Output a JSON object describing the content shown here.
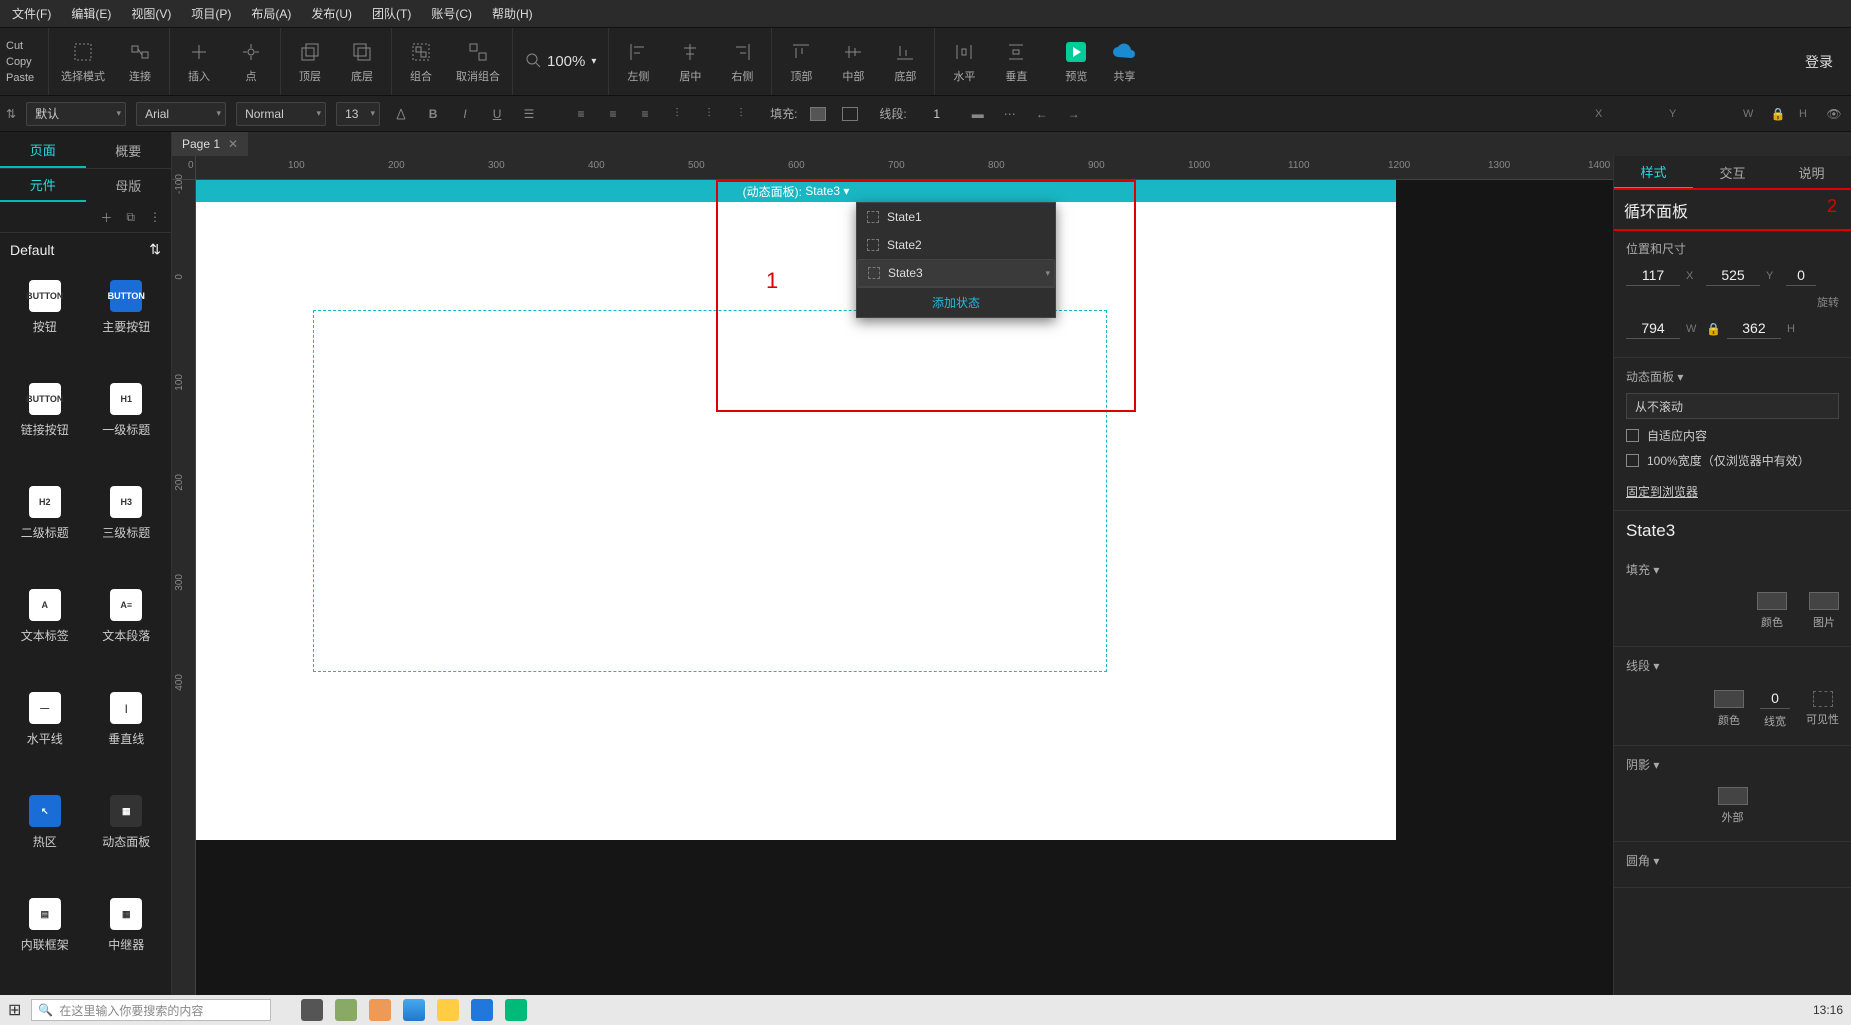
{
  "menubar": {
    "file": "文件(F)",
    "edit": "编辑(E)",
    "view": "视图(V)",
    "project": "项目(P)",
    "layout": "布局(A)",
    "publish": "发布(U)",
    "team": "团队(T)",
    "account": "账号(C)",
    "help": "帮助(H)"
  },
  "cutcopy": {
    "cut": "Cut",
    "copy": "Copy",
    "paste": "Paste"
  },
  "toolbar1": {
    "select_mode": "选择模式",
    "connect": "连接",
    "insert": "插入",
    "point": "点",
    "top_layer": "顶层",
    "bottom_layer": "底层",
    "group": "组合",
    "ungroup": "取消组合",
    "zoom_value": "100%",
    "align_left": "左侧",
    "align_center_h": "居中",
    "align_right": "右侧",
    "align_top": "顶部",
    "align_middle": "中部",
    "align_bottom": "底部",
    "dist_h": "水平",
    "dist_v": "垂直",
    "preview": "预览",
    "share": "共享",
    "login": "登录"
  },
  "toolbar2": {
    "default": "默认",
    "font": "Arial",
    "weight": "Normal",
    "size": "13",
    "fill_label": "填充:",
    "line_label": "线段:",
    "line_value": "1",
    "x": "X",
    "y": "Y",
    "w": "W",
    "h": "H"
  },
  "left": {
    "tab_page": "页面",
    "tab_outline": "概要",
    "tab_widgets": "元件",
    "tab_master": "母版",
    "lib_name": "Default",
    "items": [
      {
        "label": "按钮",
        "txt": "BUTTON",
        "cls": ""
      },
      {
        "label": "主要按钮",
        "txt": "BUTTON",
        "cls": "blue"
      },
      {
        "label": "链接按钮",
        "txt": "BUTTON",
        "cls": ""
      },
      {
        "label": "一级标题",
        "txt": "H1",
        "cls": ""
      },
      {
        "label": "二级标题",
        "txt": "H2",
        "cls": ""
      },
      {
        "label": "三级标题",
        "txt": "H3",
        "cls": ""
      },
      {
        "label": "文本标签",
        "txt": "A",
        "cls": ""
      },
      {
        "label": "文本段落",
        "txt": "A≡",
        "cls": ""
      },
      {
        "label": "水平线",
        "txt": "—",
        "cls": ""
      },
      {
        "label": "垂直线",
        "txt": "|",
        "cls": ""
      },
      {
        "label": "热区",
        "txt": "↖",
        "cls": "blue"
      },
      {
        "label": "动态面板",
        "txt": "▦",
        "cls": "dark"
      },
      {
        "label": "内联框架",
        "txt": "▤",
        "cls": ""
      },
      {
        "label": "中继器",
        "txt": "▦",
        "cls": ""
      }
    ]
  },
  "tab": {
    "page1": "Page 1"
  },
  "canvas": {
    "panel_label": "(动态面板):",
    "current_state": "State3",
    "states": [
      "State1",
      "State2",
      "State3"
    ],
    "add_state": "添加状态",
    "annot1": "1",
    "annot2": "2",
    "ruler_h": [
      "0",
      "100",
      "200",
      "300",
      "400",
      "500",
      "600",
      "700",
      "800",
      "900",
      "1000",
      "1100",
      "1200",
      "1300",
      "1400"
    ],
    "ruler_v": [
      "-100",
      "0",
      "100",
      "200",
      "300",
      "400"
    ]
  },
  "right": {
    "tab_style": "样式",
    "tab_interact": "交互",
    "tab_notes": "说明",
    "name": "循环面板",
    "pos_label": "位置和尺寸",
    "x": "117",
    "y": "525",
    "rot": "0",
    "w": "794",
    "h": "362",
    "rot_label": "旋转",
    "dp_label": "动态面板 ▾",
    "scroll": "从不滚动",
    "fit": "自适应内容",
    "wide": "100%宽度（仅浏览器中有效）",
    "pin": "固定到浏览器",
    "state_hdr": "State3",
    "fill_label": "填充 ▾",
    "color": "颜色",
    "image": "图片",
    "line_label": "线段 ▾",
    "line_color": "颜色",
    "line_width_val": "0",
    "line_width": "线宽",
    "line_vis": "可见性",
    "shadow_label": "阴影 ▾",
    "shadow_outer": "外部",
    "corner_label": "圆角 ▾"
  },
  "taskbar": {
    "search_placeholder": "在这里输入你要搜索的内容",
    "clock": "13:16"
  }
}
